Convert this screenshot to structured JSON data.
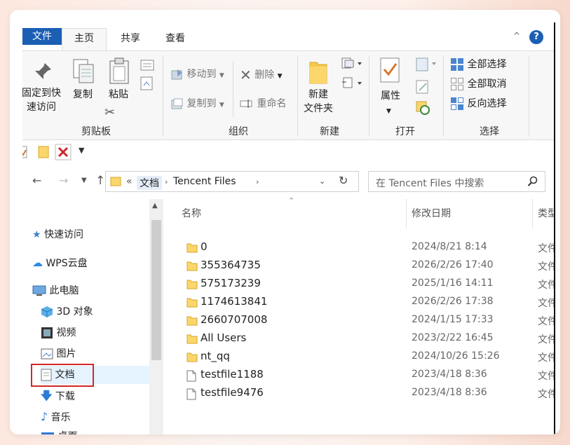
{
  "window": {
    "tabs": [
      "文件",
      "主页",
      "共享",
      "查看"
    ],
    "help_label": "?"
  },
  "ribbon": {
    "clipboard": {
      "pin_label_1": "固定到快",
      "pin_label_2": "速访问",
      "copy": "复制",
      "paste": "粘贴",
      "group": "剪贴板"
    },
    "organize": {
      "move_to": "移动到",
      "copy_to": "复制到",
      "delete": "删除",
      "rename": "重命名",
      "group": "组织"
    },
    "new": {
      "new_folder_1": "新建",
      "new_folder_2": "文件夹",
      "group": "新建"
    },
    "open": {
      "properties": "属性",
      "group": "打开"
    },
    "select": {
      "select_all": "全部选择",
      "select_none": "全部取消",
      "invert": "反向选择",
      "group": "选择"
    }
  },
  "address": {
    "overflow": "«",
    "crumbs": [
      "文档",
      "Tencent Files"
    ],
    "search_placeholder": "在 Tencent Files 中搜索"
  },
  "nav_pane": {
    "items": [
      {
        "label": "快速访问",
        "icon": "star-icon"
      },
      {
        "label": "WPS云盘",
        "icon": "cloud-icon"
      },
      {
        "label": "此电脑",
        "icon": "computer-icon"
      },
      {
        "label": "3D 对象",
        "icon": "cube-icon"
      },
      {
        "label": "视频",
        "icon": "video-icon"
      },
      {
        "label": "图片",
        "icon": "picture-icon"
      },
      {
        "label": "文档",
        "icon": "document-icon"
      },
      {
        "label": "下载",
        "icon": "download-icon"
      },
      {
        "label": "音乐",
        "icon": "music-icon"
      },
      {
        "label": "桌面",
        "icon": "desktop-icon"
      }
    ]
  },
  "file_list": {
    "columns": [
      "名称",
      "修改日期",
      "类型"
    ],
    "rows": [
      {
        "name": "0",
        "date": "2024/8/21 8:14",
        "type": "文件",
        "kind": "folder"
      },
      {
        "name": "355364735",
        "date": "2026/2/26 17:40",
        "type": "文件",
        "kind": "folder"
      },
      {
        "name": "575173239",
        "date": "2025/1/16 14:11",
        "type": "文件",
        "kind": "folder"
      },
      {
        "name": "1174613841",
        "date": "2026/2/26 17:38",
        "type": "文件",
        "kind": "folder"
      },
      {
        "name": "2660707008",
        "date": "2024/1/15 17:33",
        "type": "文件",
        "kind": "folder"
      },
      {
        "name": "All Users",
        "date": "2023/2/22 16:45",
        "type": "文件",
        "kind": "folder"
      },
      {
        "name": "nt_qq",
        "date": "2024/10/26 15:26",
        "type": "文件",
        "kind": "folder"
      },
      {
        "name": "testfile1188",
        "date": "2023/4/18 8:36",
        "type": "文件",
        "kind": "file"
      },
      {
        "name": "testfile9476",
        "date": "2023/4/18 8:36",
        "type": "文件",
        "kind": "file"
      }
    ]
  }
}
